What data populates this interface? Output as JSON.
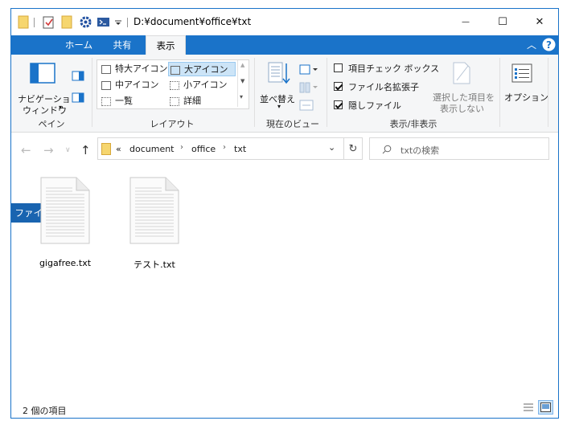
{
  "window": {
    "title": "D:¥document¥office¥txt",
    "accent": "#1a73c9"
  },
  "quick_access": {
    "icons": [
      "folder-icon",
      "properties-icon",
      "new-folder-icon",
      "gear-icon",
      "powershell-icon",
      "customize-dropdown-icon"
    ]
  },
  "window_controls": {
    "minimize": "—",
    "maximize": "☐",
    "close": "✕"
  },
  "tabs": [
    {
      "label": "ファイル"
    },
    {
      "label": "ホーム"
    },
    {
      "label": "共有"
    },
    {
      "label": "表示"
    }
  ],
  "ribbon": {
    "pane": {
      "nav_pane_label_1": "ナビゲーション",
      "nav_pane_label_2": "ウィンドウ",
      "group": "ペイン"
    },
    "layout": {
      "items": [
        "特大アイコン",
        "大アイコン",
        "中アイコン",
        "小アイコン",
        "一覧",
        "詳細"
      ],
      "selected": "大アイコン",
      "group": "レイアウト"
    },
    "current_view": {
      "sort_label": "並べ替え",
      "group": "現在のビュー"
    },
    "show_hide": {
      "item_checkboxes": {
        "label": "項目チェック ボックス",
        "checked": false
      },
      "file_extensions": {
        "label": "ファイル名拡張子",
        "checked": true
      },
      "hidden_items": {
        "label": "隠しファイル",
        "checked": true
      },
      "hide_selected_1": "選択した項目を",
      "hide_selected_2": "表示しない",
      "group": "表示/非表示"
    },
    "options_label": "オプション"
  },
  "address_bar": {
    "overflow": "«",
    "path": [
      "document",
      "office",
      "txt"
    ],
    "search_placeholder": "txtの検索"
  },
  "files": [
    {
      "name": "gigafree.txt"
    },
    {
      "name": "テスト.txt"
    }
  ],
  "status_bar": {
    "item_count": "2 個の項目"
  }
}
